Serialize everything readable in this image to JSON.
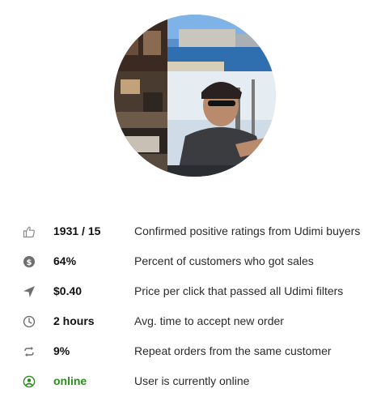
{
  "profile": {
    "avatar_alt": "seller profile photo"
  },
  "stats": [
    {
      "icon": "thumbs-up-icon",
      "value": "1931 / 15",
      "description": "Confirmed positive ratings from Udimi buyers"
    },
    {
      "icon": "dollar-circle-icon",
      "value": "64%",
      "description": "Percent of customers who got sales"
    },
    {
      "icon": "location-arrow-icon",
      "value": "$0.40",
      "description": "Price per click that passed all Udimi filters"
    },
    {
      "icon": "clock-icon",
      "value": "2 hours",
      "description": "Avg. time to accept new order"
    },
    {
      "icon": "repeat-icon",
      "value": "9%",
      "description": "Repeat orders from the same customer"
    },
    {
      "icon": "user-circle-icon",
      "value": "online",
      "description": "User is currently online"
    }
  ],
  "colors": {
    "icon_gray": "#8a8a8a",
    "online_green": "#2e8b1e",
    "text": "#2b2b2b"
  }
}
